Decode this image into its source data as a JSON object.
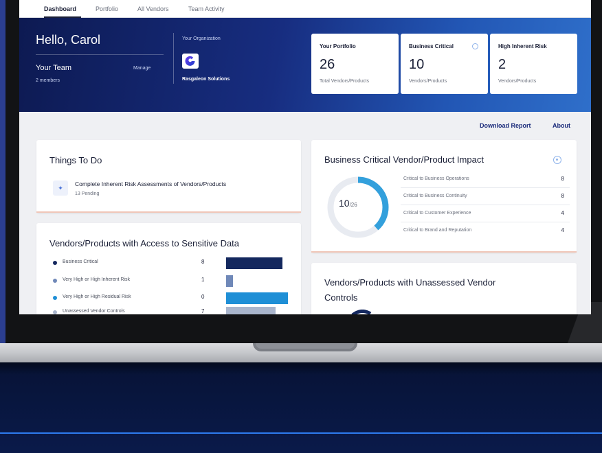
{
  "nav": {
    "tabs": [
      "Dashboard",
      "Portfolio",
      "All Vendors",
      "Team Activity"
    ],
    "active": "Dashboard"
  },
  "hero": {
    "greeting": "Hello, Carol",
    "team_label": "Your Team",
    "manage_label": "Manage",
    "members": "2 members",
    "org_label": "Your Organization",
    "org_name": "Rasgaleon Solutions"
  },
  "stats": [
    {
      "label": "Your Portfolio",
      "value": "26",
      "sub": "Total Vendors/Products"
    },
    {
      "label": "Business Critical",
      "value": "10",
      "sub": "Vendors/Products"
    },
    {
      "label": "High Inherent Risk",
      "value": "2",
      "sub": "Vendors/Products"
    }
  ],
  "links": {
    "download": "Download Report",
    "about": "About"
  },
  "todo": {
    "title": "Things To Do",
    "item_title": "Complete Inherent Risk Assessments of Vendors/Products",
    "item_sub": "13 Pending"
  },
  "sensitive": {
    "title": "Vendors/Products with Access to Sensitive Data",
    "rows": [
      {
        "label": "Business Critical",
        "value": 8,
        "color": "#14285e"
      },
      {
        "label": "Very High or High Inherent Risk",
        "value": 1,
        "color": "#6f88b8"
      },
      {
        "label": "Very High or High Residual Risk",
        "value": 0,
        "color": "#1f8fd6"
      },
      {
        "label": "Unassessed Vendor Controls",
        "value": 7,
        "color": "#a9b5cc"
      }
    ]
  },
  "impact": {
    "title": "Business Critical Vendor/Product Impact",
    "donut_value": "10",
    "donut_total": "/26",
    "rows": [
      {
        "label": "Critical to Business Operations",
        "value": "8"
      },
      {
        "label": "Critical to Business Continuity",
        "value": "8"
      },
      {
        "label": "Critical to Customer Experience",
        "value": "4"
      },
      {
        "label": "Critical to Brand and Reputation",
        "value": "4"
      }
    ]
  },
  "unassessed": {
    "title_line1": "Vendors/Products with Unassessed Vendor",
    "title_line2": "Controls"
  }
}
